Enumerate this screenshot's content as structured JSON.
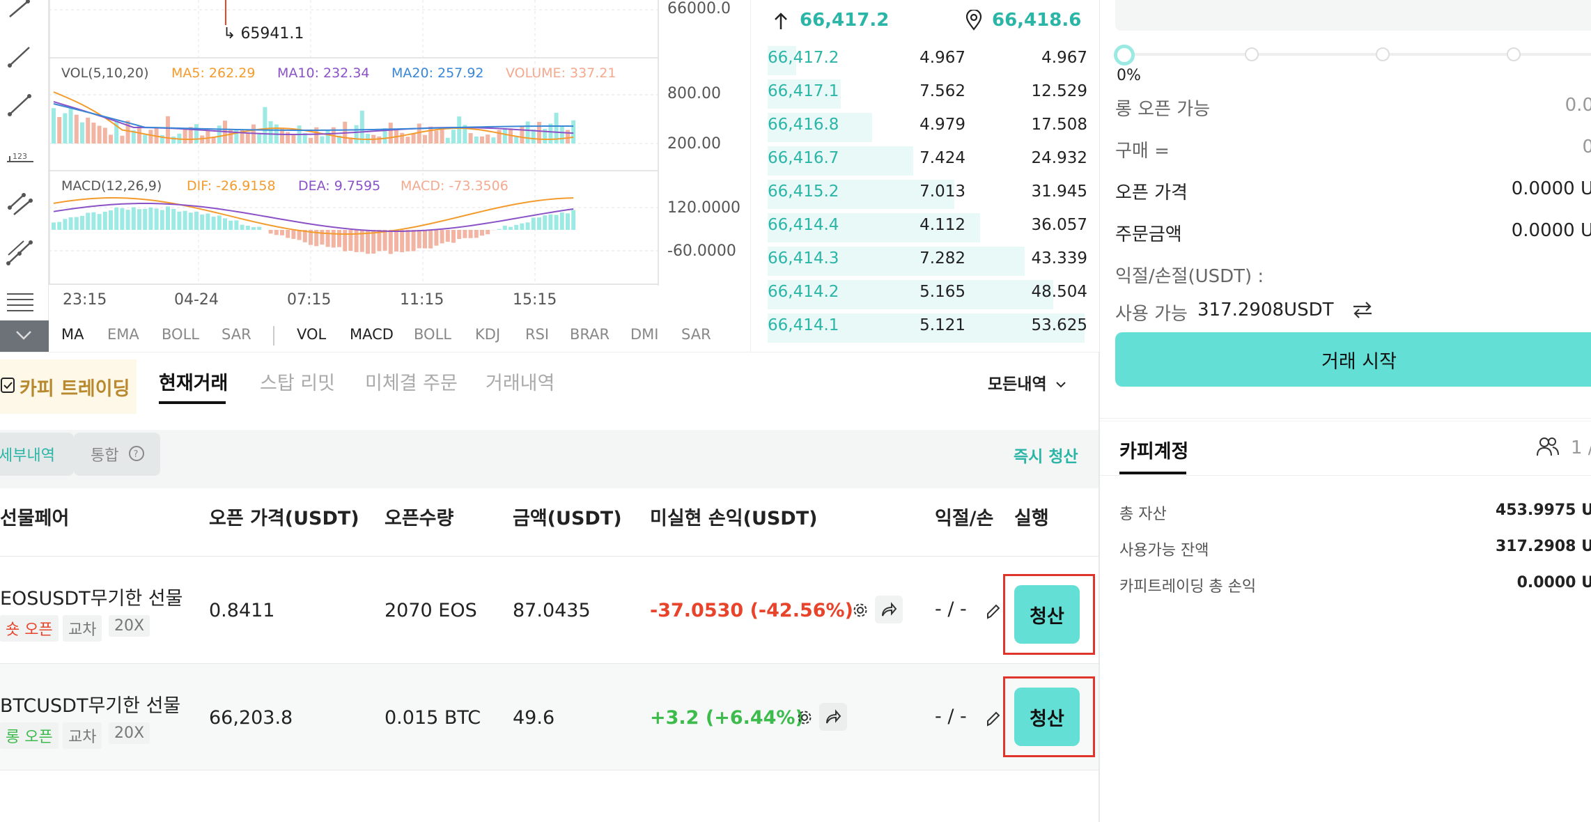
{
  "chart": {
    "price_axis": [
      "66000.0"
    ],
    "low_marker": "65941.1",
    "vol_axis": [
      "800.00",
      "200.00"
    ],
    "macd_axis": [
      "120.0000",
      "-60.0000"
    ],
    "time_axis": [
      "23:15",
      "04-24",
      "07:15",
      "11:15",
      "15:15"
    ],
    "vol_title": {
      "name": "VOL(5,10,20)",
      "ma5": "MA5: 262.29",
      "ma10": "MA10: 232.34",
      "ma20": "MA20: 257.92",
      "volume": "VOLUME: 337.21"
    },
    "macd_title": {
      "name": "MACD(12,26,9)",
      "dif": "DIF: -26.9158",
      "dea": "DEA: 9.7595",
      "macd": "MACD: -73.3506"
    },
    "indicators_main": [
      "MA",
      "EMA",
      "BOLL",
      "SAR"
    ],
    "indicators_sub": [
      "VOL",
      "MACD",
      "BOLL",
      "KDJ",
      "RSI",
      "BRAR",
      "DMI",
      "SAR"
    ]
  },
  "orderbook": {
    "last_price": "66,417.2",
    "mark_price": "66,418.6",
    "rows": [
      {
        "price": "66,417.2",
        "amount": "4.967",
        "total": "4.967",
        "depth": 0.09
      },
      {
        "price": "66,417.1",
        "amount": "7.562",
        "total": "12.529",
        "depth": 0.23
      },
      {
        "price": "66,416.8",
        "amount": "4.979",
        "total": "17.508",
        "depth": 0.33
      },
      {
        "price": "66,416.7",
        "amount": "7.424",
        "total": "24.932",
        "depth": 0.46
      },
      {
        "price": "66,415.2",
        "amount": "7.013",
        "total": "31.945",
        "depth": 0.59
      },
      {
        "price": "66,414.4",
        "amount": "4.112",
        "total": "36.057",
        "depth": 0.67
      },
      {
        "price": "66,414.3",
        "amount": "7.282",
        "total": "43.339",
        "depth": 0.81
      },
      {
        "price": "66,414.2",
        "amount": "5.165",
        "total": "48.504",
        "depth": 0.9
      },
      {
        "price": "66,414.1",
        "amount": "5.121",
        "total": "53.625",
        "depth": 1.0
      }
    ]
  },
  "order_panel": {
    "slider_pct": "0%",
    "rows": [
      {
        "label": "롱 오픈 가능",
        "value": "0.0"
      },
      {
        "label": "구매 =",
        "value": "0"
      },
      {
        "label": "오픈 가격",
        "value": "0.0000 U"
      },
      {
        "label": "주문금액",
        "value": "0.0000 U"
      }
    ],
    "pnl_label": "익절/손절(USDT) :",
    "available_label": "사용 가능",
    "available_value": "317.2908USDT",
    "start_button": "거래 시작"
  },
  "copy_account": {
    "title": "카피계정",
    "count": "1 /",
    "rows": [
      {
        "label": "총 자산",
        "value": "453.9975 U"
      },
      {
        "label": "사용가능 잔액",
        "value": "317.2908 U"
      },
      {
        "label": "카피트레이딩 총 손익",
        "value": "0.0000 U"
      }
    ]
  },
  "tabs": {
    "copy_trading": "카피 트레이딩",
    "items": [
      "현재거래",
      "스탑 리밋",
      "미체결 주문",
      "거래내역"
    ],
    "filter": "모든내역"
  },
  "subbar": {
    "detail": "세부내역",
    "merge": "통합",
    "instant_close": "즉시 청산"
  },
  "table": {
    "headers": [
      "선물페어",
      "오픈 가격(USDT)",
      "오픈수량",
      "금액(USDT)",
      "미실현 손익(USDT)",
      "익절/손",
      "실행"
    ],
    "rows": [
      {
        "pair": "EOSUSDT무기한 선물",
        "side": "숏 오픈",
        "mode": "교차",
        "leverage": "20X",
        "open_price": "0.8411",
        "qty": "2070 EOS",
        "amount": "87.0435",
        "pnl": "-37.0530 (-42.56%)",
        "tpsl": "- / -",
        "action": "청산"
      },
      {
        "pair": "BTCUSDT무기한 선물",
        "side": "롱 오픈",
        "mode": "교차",
        "leverage": "20X",
        "open_price": "66,203.8",
        "qty": "0.015 BTC",
        "amount": "49.6",
        "pnl": "+3.2 (+6.44%)",
        "tpsl": "- / -",
        "action": "청산"
      }
    ]
  },
  "colors": {
    "teal": "#2bb5a7",
    "button": "#63dfd5",
    "red": "#e8442c",
    "green": "#3dbb4c",
    "ma5": "#f39b2c",
    "ma10": "#8b52c7",
    "ma20": "#3a86d6"
  }
}
